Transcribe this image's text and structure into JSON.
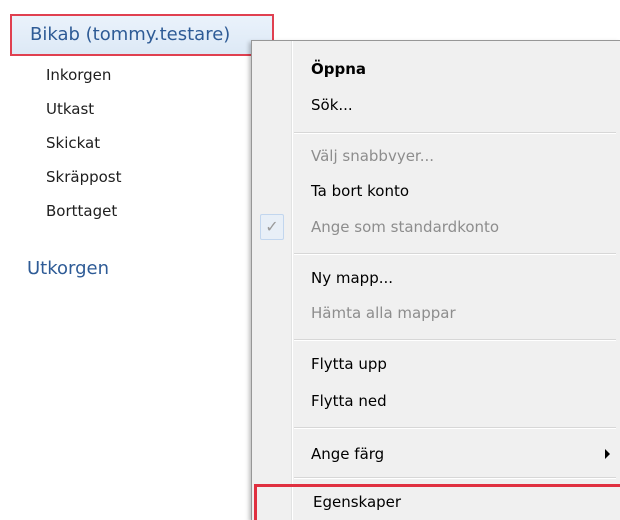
{
  "folder_pane": {
    "account": "Bikab (tommy.testare)",
    "folders": [
      "Inkorgen",
      "Utkast",
      "Skickat",
      "Skräppost",
      "Borttaget"
    ],
    "outbox": "Utkorgen"
  },
  "context_menu": {
    "open": "Öppna",
    "search": "Sök...",
    "quick_views": "Välj snabbvyer...",
    "remove_account": "Ta bort konto",
    "check_mark": "✓",
    "set_default": "Ange som standardkonto",
    "new_folder": "Ny mapp...",
    "fetch_all_folders": "Hämta alla mappar",
    "move_up": "Flytta upp",
    "move_down": "Flytta ned",
    "set_color": "Ange färg",
    "properties": "Egenskaper"
  },
  "colors": {
    "highlight_border": "#e03040",
    "account_text": "#2e5b96",
    "disabled_text": "#8d8d8d"
  }
}
